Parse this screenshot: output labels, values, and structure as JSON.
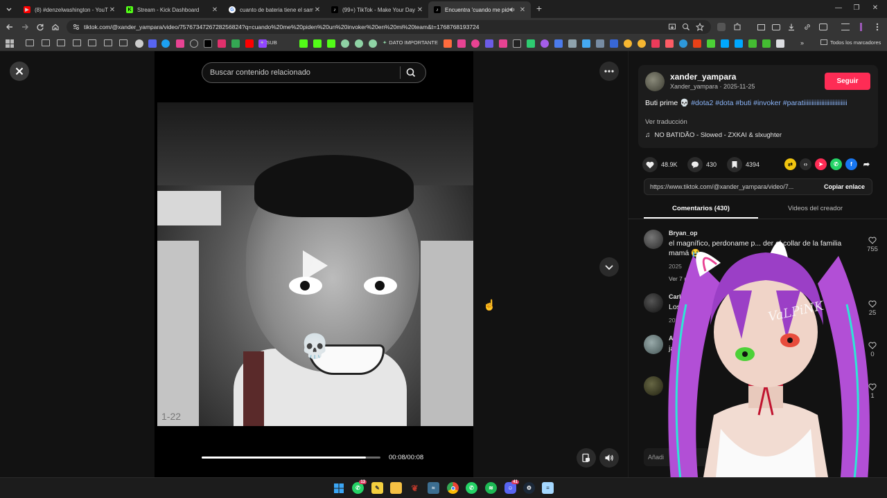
{
  "browser": {
    "tabs": [
      {
        "title": "(8) #denzelwashington - YouTube",
        "favicon_color": "#ff0000"
      },
      {
        "title": "Stream - Kick Dashboard",
        "favicon_color": "#53fc18"
      },
      {
        "title": "cuanto de bateria tiene el samsung",
        "favicon_color": "#ffffff"
      },
      {
        "title": "(99+) TikTok - Make Your Day",
        "favicon_color": "#000000"
      },
      {
        "title": "Encuentra 'cuando me pide",
        "favicon_color": "#000000",
        "active": true
      }
    ],
    "url": "tiktok.com/@xander_yampara/video/7576734726728256824?q=cuando%20me%20piden%20un%20invoker%20en%20mi%20team&t=1768768193724",
    "bookmarks": {
      "sub_label": "SUB",
      "dato_label": "DATO IMPORTANTE",
      "all_label": "Todos los marcadores"
    }
  },
  "player": {
    "search_placeholder": "Buscar contenido relacionado",
    "time": "00:08/00:08",
    "progress": 0.92,
    "watermark": "1-22"
  },
  "author": {
    "username": "xander_yampara",
    "subline": "Xander_yampara · 2025-11-25",
    "follow_label": "Seguir",
    "caption_text": "Buti prime 💀",
    "hashtags": [
      "#dota2",
      "#dota",
      "#buti",
      "#invoker",
      "#paratiiiiiiiiiiiiiiiiiiiiiiiiiii"
    ],
    "translate_label": "Ver traducción",
    "sound": "NO BATIDÃO - Slowed - ZXKAI & slxughter"
  },
  "stats": {
    "likes": "48.9K",
    "comments": "430",
    "saves": "4394"
  },
  "share": {
    "link": "https://www.tiktok.com/@xander_yampara/video/7...",
    "copy_label": "Copiar enlace"
  },
  "panel_tabs": {
    "comments": "Comentarios (430)",
    "creator_videos": "Videos del creador"
  },
  "comments": [
    {
      "user": "Bryan_op",
      "text": "el magnífico, perdoname p... der el collar de la familia mamá 😭",
      "date": "2025",
      "replies": "Ver 7 res",
      "likes": "755"
    },
    {
      "user": "Carlos",
      "text": "Los r",
      "date": "202",
      "likes": "25"
    },
    {
      "user": "Ac",
      "text": "ja",
      "date": "",
      "likes": "0"
    },
    {
      "user": "",
      "text": "",
      "date": "",
      "likes": "1"
    }
  ],
  "comment_input_placeholder": "Añadi",
  "vtuber_label": "VaLPiNK",
  "taskbar": {
    "whatsapp_badge": "13",
    "discord_badge": "41"
  }
}
